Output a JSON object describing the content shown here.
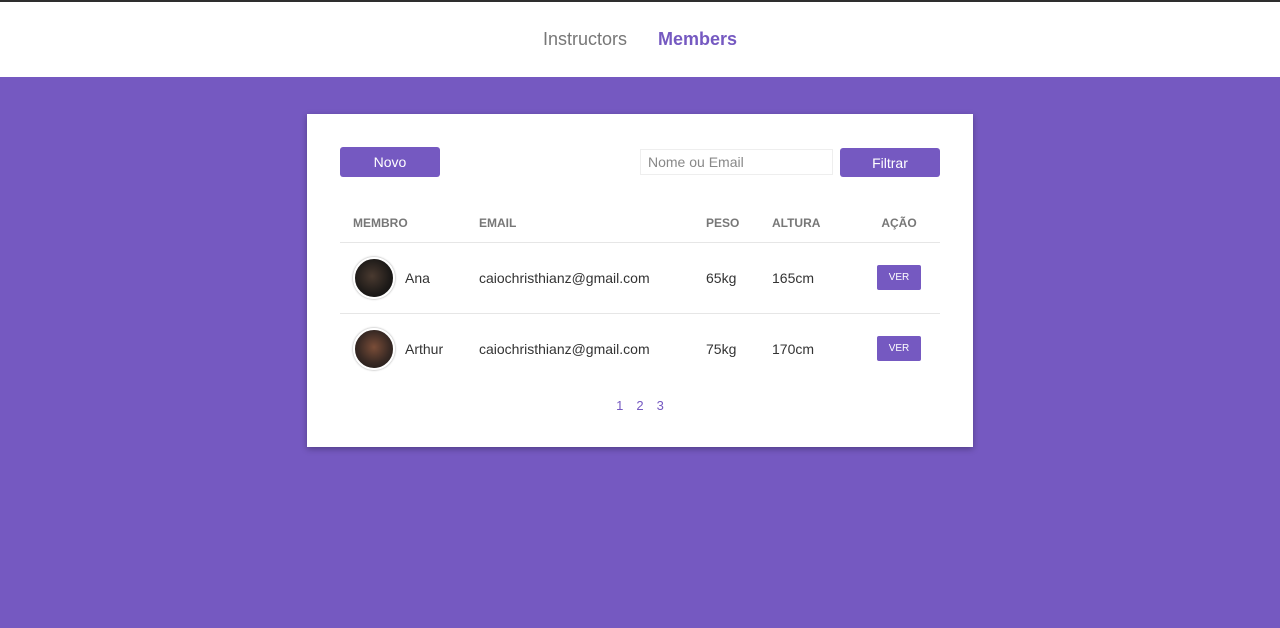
{
  "nav": {
    "items": [
      {
        "label": "Instructors",
        "active": false
      },
      {
        "label": "Members",
        "active": true
      }
    ]
  },
  "toolbar": {
    "new_label": "Novo",
    "search_placeholder": "Nome ou Email",
    "search_value": "",
    "filter_label": "Filtrar"
  },
  "table": {
    "headers": [
      "Membro",
      "Email",
      "Peso",
      "Altura",
      "Ação"
    ],
    "rows": [
      {
        "name": "Ana",
        "email": "caiochristhianz@gmail.com",
        "weight": "65kg",
        "height": "165cm",
        "action": "Ver"
      },
      {
        "name": "Arthur",
        "email": "caiochristhianz@gmail.com",
        "weight": "75kg",
        "height": "170cm",
        "action": "Ver"
      }
    ]
  },
  "pagination": {
    "pages": [
      "1",
      "2",
      "3"
    ]
  },
  "colors": {
    "accent": "#7559c1",
    "background": "#7559c1",
    "card": "#ffffff"
  }
}
